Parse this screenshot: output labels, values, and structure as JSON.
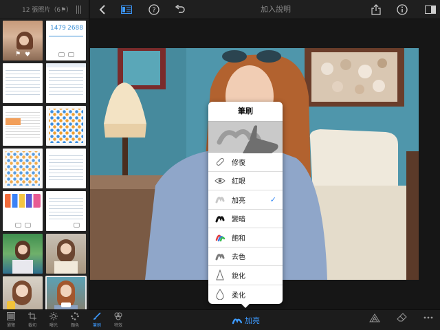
{
  "sidebar": {
    "header": "12 張照片（6⚑）",
    "thumbnails": [
      {
        "kind": "photo-room",
        "selected": false
      },
      {
        "kind": "stats",
        "left_num": "1479",
        "right_num": "2688"
      },
      {
        "kind": "settings-list"
      },
      {
        "kind": "settings-list"
      },
      {
        "kind": "settings-list"
      },
      {
        "kind": "app-grid"
      },
      {
        "kind": "app-grid"
      },
      {
        "kind": "settings-list"
      },
      {
        "kind": "app-icons"
      },
      {
        "kind": "settings-list"
      },
      {
        "kind": "photo-girl"
      },
      {
        "kind": "photo-girl"
      },
      {
        "kind": "photo-girl"
      },
      {
        "kind": "photo-girl",
        "selected": true
      }
    ]
  },
  "topbar": {
    "title": "加入說明",
    "icons": [
      "chevron-left-icon",
      "browse-icon",
      "help-icon",
      "undo-icon",
      "share-icon",
      "info-icon",
      "sidebar-toggle-icon"
    ]
  },
  "popover": {
    "title": "筆刷",
    "items": [
      {
        "label": "修復",
        "icon": "bandage-icon",
        "checked": false
      },
      {
        "label": "紅眼",
        "icon": "eye-icon",
        "checked": false
      },
      {
        "label": "加亮",
        "icon": "light-brush-icon",
        "checked": true
      },
      {
        "label": "變暗",
        "icon": "dark-brush-icon",
        "checked": false
      },
      {
        "label": "飽和",
        "icon": "saturate-brush-icon",
        "checked": false
      },
      {
        "label": "去色",
        "icon": "desaturate-brush-icon",
        "checked": false
      },
      {
        "label": "銳化",
        "icon": "sharpen-icon",
        "checked": false
      },
      {
        "label": "柔化",
        "icon": "drop-icon",
        "checked": false
      }
    ]
  },
  "bottombar": {
    "tools": [
      {
        "label": "瀏覽",
        "icon": "browse-icon",
        "active": false
      },
      {
        "label": "裁切",
        "icon": "crop-icon",
        "active": false
      },
      {
        "label": "曝光",
        "icon": "exposure-icon",
        "active": false
      },
      {
        "label": "顏色",
        "icon": "color-icon",
        "active": false
      },
      {
        "label": "筆刷",
        "icon": "brush-icon",
        "active": true
      },
      {
        "label": "特效",
        "icon": "effects-icon",
        "active": false
      }
    ],
    "current_brush": "加亮",
    "right_icons": [
      "brush-layers-icon",
      "eraser-icon",
      "more-icon"
    ]
  },
  "colors": {
    "accent": "#3d9aff",
    "check": "#2f86f5",
    "toolbar_bg": "#1f1f1f"
  }
}
